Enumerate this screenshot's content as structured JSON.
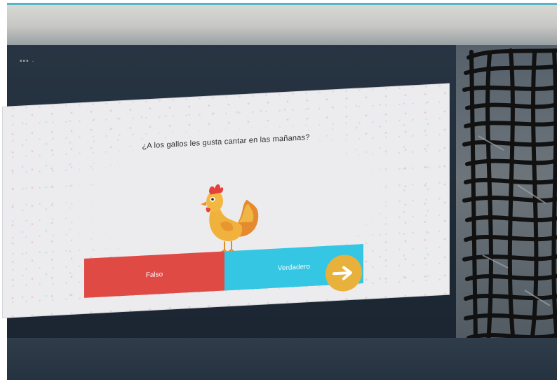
{
  "screen": {
    "quiz": {
      "question": "¿A los gallos les gusta cantar en las mañanas?",
      "answers": [
        {
          "label": "Falso",
          "color": "#e04a45"
        },
        {
          "label": "Verdadero",
          "color": "#35c6e3"
        }
      ],
      "illustration_icon": "rooster-icon",
      "next_icon": "arrow-right-icon",
      "next_color": "#e8b13b"
    },
    "background": {
      "top_text": "▪▪▪ ·"
    }
  }
}
